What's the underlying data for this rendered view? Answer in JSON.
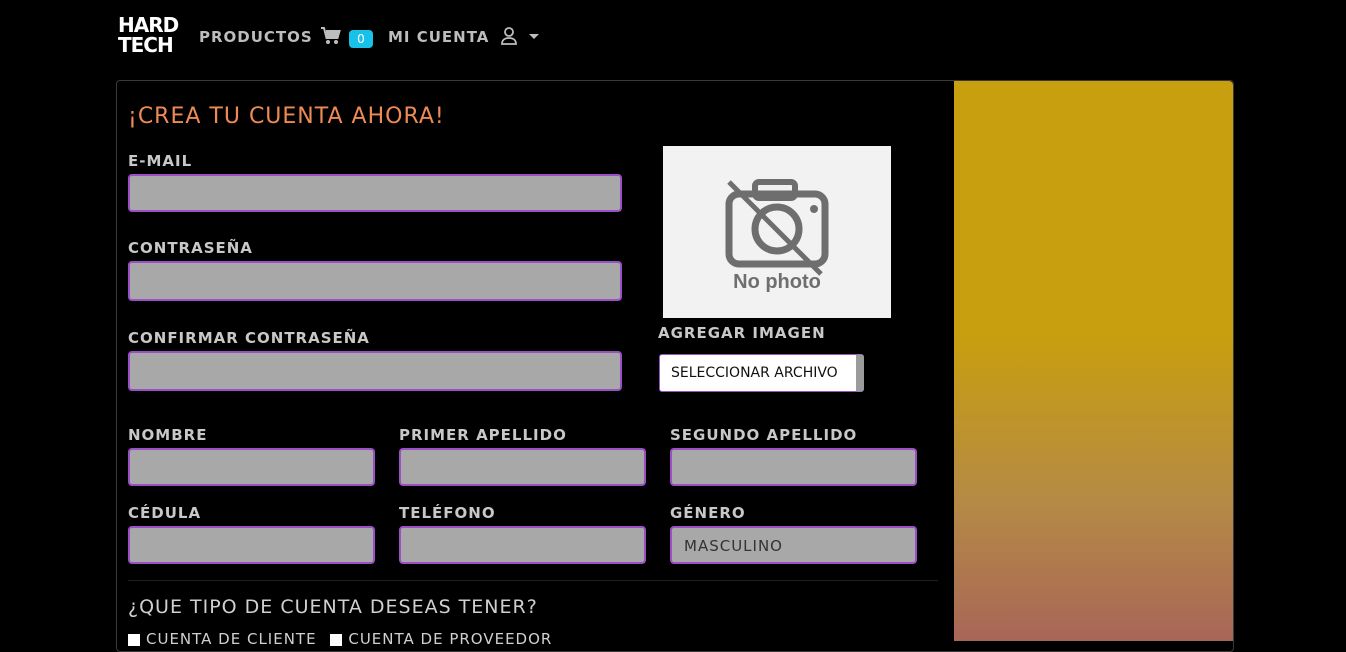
{
  "nav": {
    "logo_line1": "HARD",
    "logo_line2": "TECH",
    "productos": "PRODUCTOS",
    "cart_count": "0",
    "mi_cuenta": "MI CUENTA"
  },
  "form": {
    "title": "¡CREA TU CUENTA AHORA!",
    "email_label": "E-MAIL",
    "email_value": "",
    "password_label": "CONTRASEÑA",
    "password_value": "",
    "confirm_label": "CONFIRMAR CONTRASEÑA",
    "confirm_value": "",
    "nombre_label": "NOMBRE",
    "primer_apellido_label": "PRIMER APELLIDO",
    "segundo_apellido_label": "SEGUNDO APELLIDO",
    "cedula_label": "CÉDULA",
    "telefono_label": "TELÉFONO",
    "genero_label": "GÉNERO",
    "genero_value": "MASCULINO",
    "image_label": "AGREGAR IMAGEN",
    "file_button": "SELECCIONAR ARCHIVO",
    "photo_caption": "No photo",
    "account_question": "¿QUE TIPO DE CUENTA DESEAS TENER?",
    "opt_cliente": "CUENTA DE CLIENTE",
    "opt_proveedor": "CUENTA DE PROVEEDOR"
  },
  "colors": {
    "accent": "#9b4fc7",
    "title": "#ef8a54",
    "badge": "#17c1e8",
    "panel_top": "#c89f0e",
    "panel_bottom": "#a86658"
  }
}
